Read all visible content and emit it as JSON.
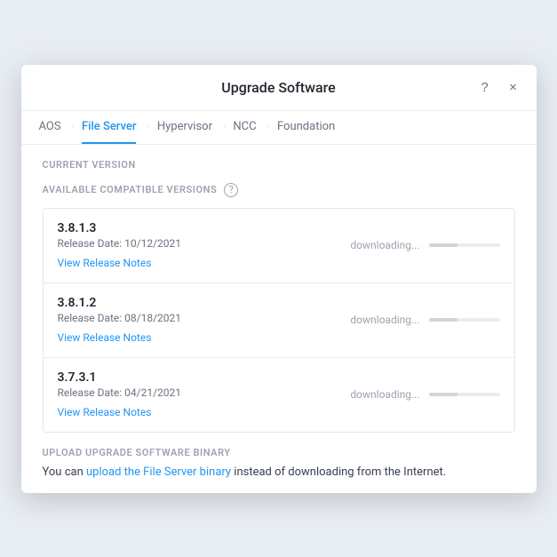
{
  "modal": {
    "title": "Upgrade Software",
    "help_icon": "?",
    "close_icon": "×"
  },
  "tabs": [
    {
      "label": "AOS",
      "active": false
    },
    {
      "label": "File Server",
      "active": true
    },
    {
      "label": "Hypervisor",
      "active": false
    },
    {
      "label": "NCC",
      "active": false
    },
    {
      "label": "Foundation",
      "active": false
    }
  ],
  "current_version_label": "CURRENT VERSION",
  "available_versions_label": "AVAILABLE COMPATIBLE VERSIONS",
  "versions": [
    {
      "number": "3.8.1.3",
      "release_date": "Release Date: 10/12/2021",
      "view_notes": "View Release Notes",
      "status": "downloading...",
      "progress": 40
    },
    {
      "number": "3.8.1.2",
      "release_date": "Release Date: 08/18/2021",
      "view_notes": "View Release Notes",
      "status": "downloading...",
      "progress": 40
    },
    {
      "number": "3.7.3.1",
      "release_date": "Release Date: 04/21/2021",
      "view_notes": "View Release Notes",
      "status": "downloading...",
      "progress": 40
    }
  ],
  "upload_section": {
    "label": "UPLOAD UPGRADE SOFTWARE BINARY",
    "text_before_link": "You can ",
    "link_text": "upload the File Server binary",
    "text_after_link": " instead of downloading from the Internet."
  }
}
